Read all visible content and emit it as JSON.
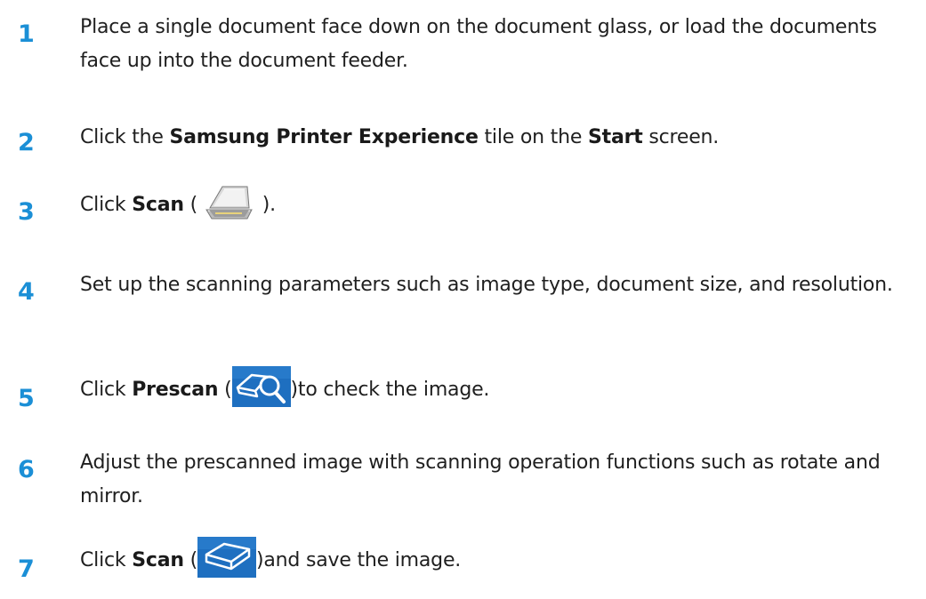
{
  "steps": [
    {
      "number": "1",
      "text": "Place a single document face down on the document glass, or load the documents face up into the document feeder."
    },
    {
      "number": "2",
      "prefix": "Click the ",
      "bold1": "Samsung Printer Experience",
      "middle": " tile on the ",
      "bold2": "Start",
      "suffix": " screen."
    },
    {
      "number": "3",
      "prefix": "Click ",
      "bold": "Scan",
      "open_paren": " (",
      "close_paren": " ).",
      "icon": "scanner-icon"
    },
    {
      "number": "4",
      "text": "Set up the scanning parameters such as image type, document size, and resolution."
    },
    {
      "number": "5",
      "prefix": "Click ",
      "bold": "Prescan",
      "open_paren": " (",
      "suffix": ")to check the image.",
      "icon": "prescan-magnifier-icon"
    },
    {
      "number": "6",
      "text": "Adjust the prescanned image with scanning operation functions such as rotate and mirror."
    },
    {
      "number": "7",
      "prefix": "Click ",
      "bold": "Scan",
      "open_paren": " (",
      "suffix": ")and save the image.",
      "icon": "scan-scanner-icon"
    }
  ],
  "colors": {
    "step_number": "#1b8fd6",
    "icon_blue": "#1e6fc0"
  }
}
